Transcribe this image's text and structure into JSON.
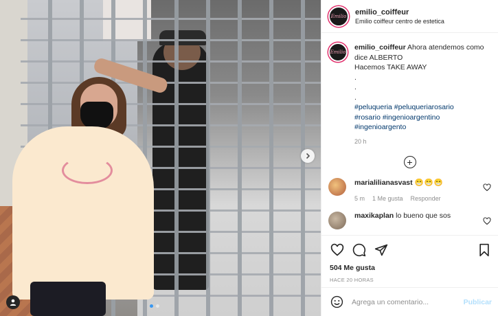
{
  "post": {
    "username": "emilio_coiffeur",
    "location": "Emilio coiffeur centro de estetica",
    "avatar_text": "Emilio",
    "caption": {
      "username": "emilio_coiffeur",
      "line1": "Ahora atendemos como dice ALBERTO",
      "line2": "Hacemos TAKE AWAY",
      "dot1": ".",
      "dot2": ".",
      "dot3": ".",
      "hashtags": [
        "#peluqueria #peluqueriarosario",
        "#rosario #ingenioargentino",
        "#ingenioargento"
      ],
      "time": "20 h"
    },
    "load_more_icon": "plus-circle-icon",
    "comments": [
      {
        "username": "marialilianasvast",
        "text": "😁😁😁",
        "time": "5 m",
        "likes": "1 Me gusta",
        "reply": "Responder"
      },
      {
        "username": "maxikaplan",
        "text": "lo bueno que sos"
      }
    ],
    "likes": "504 Me gusta",
    "posted": "HACE 20 HORAS",
    "comment_input": {
      "placeholder": "Agrega un comentario...",
      "publish_label": "Publicar"
    },
    "icons": {
      "like": "heart-icon",
      "comment": "comment-icon",
      "share": "paper-plane-icon",
      "save": "bookmark-icon",
      "emoji": "smiley-icon",
      "tag": "user-tag-icon",
      "next": "chevron-right-icon"
    },
    "colors": {
      "link": "#00376b",
      "story_ring": "#e1306c",
      "publish_disabled": "#b2dffc",
      "carousel_active": "#3897f0"
    }
  }
}
